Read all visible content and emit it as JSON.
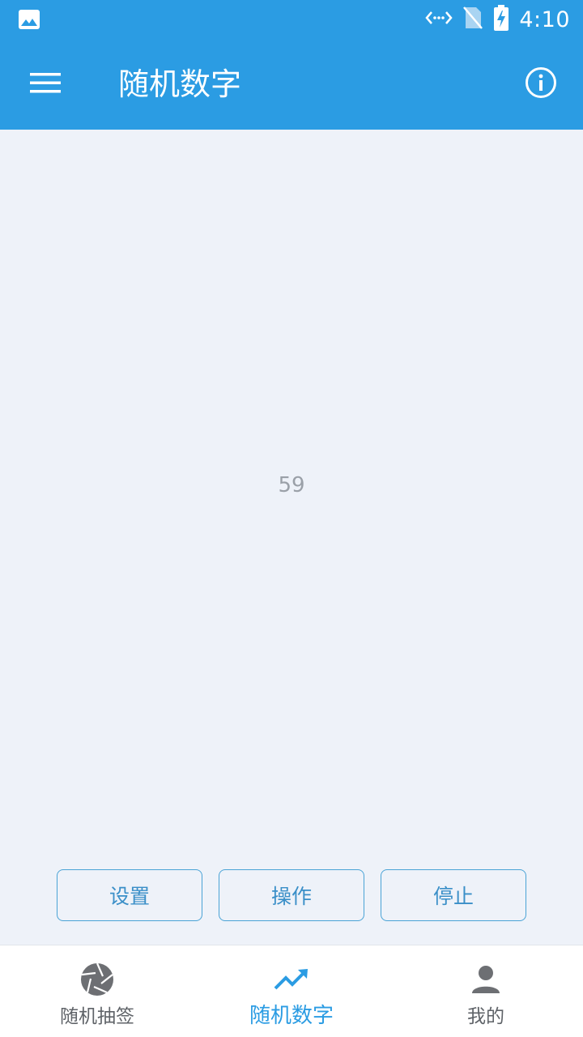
{
  "status_bar": {
    "time": "4:10",
    "left_icon": "image-icon",
    "icons": [
      "data-transfer-icon",
      "no-sim-icon",
      "battery-charging-icon"
    ]
  },
  "app_bar": {
    "title": "随机数字",
    "menu_icon": "menu-icon",
    "info_icon": "info-icon"
  },
  "main": {
    "number": "59"
  },
  "actions": {
    "settings_label": "设置",
    "operate_label": "操作",
    "stop_label": "停止"
  },
  "bottom_nav": {
    "items": [
      {
        "label": "随机抽签",
        "icon": "aperture-icon",
        "active": false
      },
      {
        "label": "随机数字",
        "icon": "trending-up-icon",
        "active": true
      },
      {
        "label": "我的",
        "icon": "person-icon",
        "active": false
      }
    ]
  },
  "colors": {
    "primary": "#2b9ce3",
    "background": "#eef2f9",
    "button_border": "#4aa3d6",
    "nav_inactive": "#5f6368"
  }
}
